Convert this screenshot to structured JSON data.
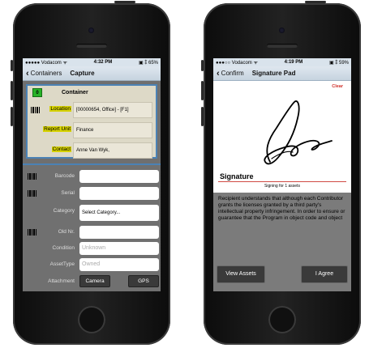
{
  "left_phone": {
    "status": {
      "carrier": "●●●●● Vodacom ᯤ",
      "time": "4:32 PM",
      "battery": "▣ ⁑ 65%"
    },
    "nav": {
      "back_label": "Containers",
      "title": "Capture"
    },
    "container": {
      "badge": "0",
      "title": "Container",
      "location_label": "Location",
      "location_value": "[00000654, Office] - [F1]",
      "report_unit_label": "Report Unit",
      "report_unit_value": "Finance",
      "contact_label": "Contact",
      "contact_value": "Anne Van Wyk,"
    },
    "form": {
      "barcode_label": "Barcode",
      "serial_label": "Serial",
      "category_label": "Category",
      "category_value": "Select Category...",
      "old_nr_label": "Old Nr.",
      "condition_label": "Condition",
      "condition_placeholder": "Unknown",
      "asset_type_label": "AssetType",
      "asset_type_placeholder": "Owned",
      "attachment_label": "Attachment",
      "camera_button": "Camera",
      "gps_button": "GPS"
    }
  },
  "right_phone": {
    "status": {
      "carrier": "●●●○○ Vodacom ᯤ",
      "time": "4:19 PM",
      "battery": "▣ ⁑ 59%"
    },
    "nav": {
      "back_label": "Confirm",
      "title": "Signature Pad"
    },
    "clear_label": "Clear",
    "signature_caption": "Signature",
    "signing_count": "Signing for 1 assets",
    "legal_text": "Recipient understands that although each Contributor grants the licenses granted by a third party's intellectual property infringement. In order to ensure or guarantee that the Program in object code and object",
    "view_assets_button": "View Assets",
    "agree_button": "I Agree"
  }
}
